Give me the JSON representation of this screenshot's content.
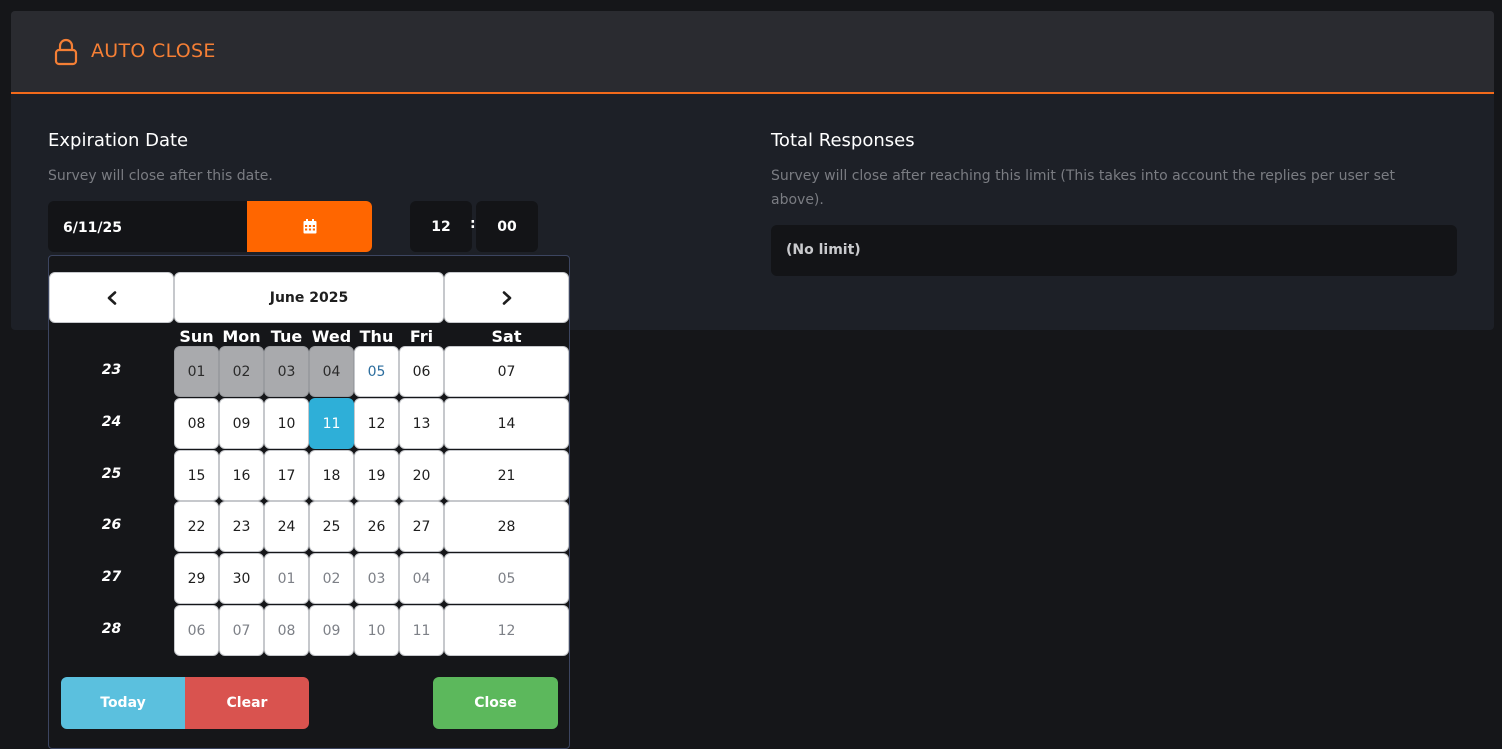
{
  "header": {
    "title": "AUTO CLOSE",
    "icon": "lock-icon",
    "accent": "#f26a1b"
  },
  "expiration": {
    "title": "Expiration Date",
    "description": "Survey will close after this date.",
    "date_value": "6/11/25",
    "calendar_icon": "calendar-icon",
    "hour": "12",
    "separator": ":",
    "minute": "00"
  },
  "responses": {
    "title": "Total Responses",
    "description": "Survey will close after reaching this limit (This takes into account the replies per user set above).",
    "value": "(No limit)"
  },
  "datepicker": {
    "month_label": "June 2025",
    "prev_icon": "chevron-left-icon",
    "next_icon": "chevron-right-icon",
    "days_of_week": [
      "Sun",
      "Mon",
      "Tue",
      "Wed",
      "Thu",
      "Fri",
      "Sat"
    ],
    "week_numbers": [
      "23",
      "24",
      "25",
      "26",
      "27",
      "28"
    ],
    "weeks": [
      [
        {
          "label": "01",
          "state": "past"
        },
        {
          "label": "02",
          "state": "past"
        },
        {
          "label": "03",
          "state": "past"
        },
        {
          "label": "04",
          "state": "past"
        },
        {
          "label": "05",
          "state": "today"
        },
        {
          "label": "06",
          "state": "normal"
        },
        {
          "label": "07",
          "state": "normal"
        }
      ],
      [
        {
          "label": "08",
          "state": "normal"
        },
        {
          "label": "09",
          "state": "normal"
        },
        {
          "label": "10",
          "state": "normal"
        },
        {
          "label": "11",
          "state": "selected"
        },
        {
          "label": "12",
          "state": "normal"
        },
        {
          "label": "13",
          "state": "normal"
        },
        {
          "label": "14",
          "state": "normal"
        }
      ],
      [
        {
          "label": "15",
          "state": "normal"
        },
        {
          "label": "16",
          "state": "normal"
        },
        {
          "label": "17",
          "state": "normal"
        },
        {
          "label": "18",
          "state": "normal"
        },
        {
          "label": "19",
          "state": "normal"
        },
        {
          "label": "20",
          "state": "normal"
        },
        {
          "label": "21",
          "state": "normal"
        }
      ],
      [
        {
          "label": "22",
          "state": "normal"
        },
        {
          "label": "23",
          "state": "normal"
        },
        {
          "label": "24",
          "state": "normal"
        },
        {
          "label": "25",
          "state": "normal"
        },
        {
          "label": "26",
          "state": "normal"
        },
        {
          "label": "27",
          "state": "normal"
        },
        {
          "label": "28",
          "state": "normal"
        }
      ],
      [
        {
          "label": "29",
          "state": "normal"
        },
        {
          "label": "30",
          "state": "normal"
        },
        {
          "label": "01",
          "state": "other"
        },
        {
          "label": "02",
          "state": "other"
        },
        {
          "label": "03",
          "state": "other"
        },
        {
          "label": "04",
          "state": "other"
        },
        {
          "label": "05",
          "state": "other"
        }
      ],
      [
        {
          "label": "06",
          "state": "other"
        },
        {
          "label": "07",
          "state": "other"
        },
        {
          "label": "08",
          "state": "other"
        },
        {
          "label": "09",
          "state": "other"
        },
        {
          "label": "10",
          "state": "other"
        },
        {
          "label": "11",
          "state": "other"
        },
        {
          "label": "12",
          "state": "other"
        }
      ]
    ],
    "buttons": {
      "today": "Today",
      "clear": "Clear",
      "close": "Close"
    },
    "colors": {
      "today_button": "#5bc0de",
      "clear_button": "#d9534f",
      "close_button": "#5cb85c",
      "selected_day": "#2eafd8",
      "past_day": "#a9aaad"
    }
  }
}
